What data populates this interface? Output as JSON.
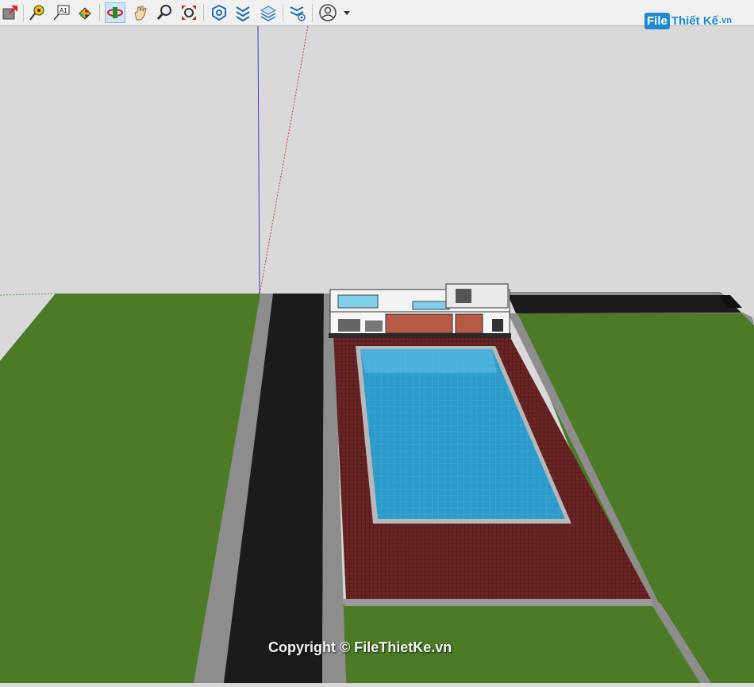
{
  "toolbar": {
    "tools": [
      {
        "name": "section-plane-icon"
      },
      {
        "name": "tape-measure-icon"
      },
      {
        "name": "text-label-icon",
        "glyph": "A1"
      },
      {
        "name": "paint-bucket-icon"
      },
      {
        "name": "orbit-icon",
        "active": true
      },
      {
        "name": "pan-icon"
      },
      {
        "name": "zoom-icon"
      },
      {
        "name": "zoom-extents-icon"
      },
      {
        "name": "warehouse-icon"
      },
      {
        "name": "components-icon"
      },
      {
        "name": "layers-icon"
      },
      {
        "name": "extension-icon"
      },
      {
        "name": "account-icon"
      }
    ]
  },
  "watermark": {
    "logo_file": "File",
    "logo_rest": "Thiết Kế",
    "logo_vn": ".vn",
    "copyright": "Copyright © FileThietKe.vn"
  },
  "colors": {
    "sky": "#d9d9d9",
    "grass": "#4c7a26",
    "road": "#1b1b1b",
    "curb": "#8d8d8d",
    "deck": "#6a2626",
    "pool": "#2f9fd0",
    "toolbar_bg": "#f0f0f0",
    "accent": "#1f8ad0"
  }
}
